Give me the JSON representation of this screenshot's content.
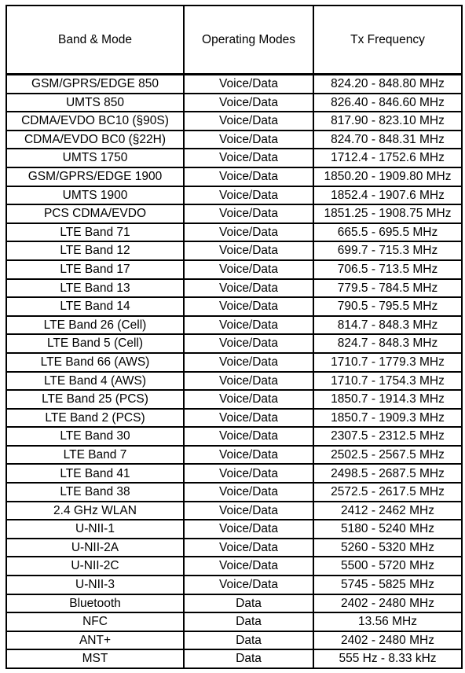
{
  "table": {
    "headers": [
      "Band & Mode",
      "Operating Modes",
      "Tx Frequency"
    ],
    "rows": [
      {
        "band": "GSM/GPRS/EDGE 850",
        "modes": "Voice/Data",
        "freq": "824.20 - 848.80 MHz"
      },
      {
        "band": "UMTS 850",
        "modes": "Voice/Data",
        "freq": "826.40 - 846.60 MHz"
      },
      {
        "band": "CDMA/EVDO BC10 (§90S)",
        "modes": "Voice/Data",
        "freq": "817.90 - 823.10 MHz"
      },
      {
        "band": "CDMA/EVDO BC0 (§22H)",
        "modes": "Voice/Data",
        "freq": "824.70 - 848.31 MHz"
      },
      {
        "band": "UMTS 1750",
        "modes": "Voice/Data",
        "freq": "1712.4 - 1752.6 MHz"
      },
      {
        "band": "GSM/GPRS/EDGE 1900",
        "modes": "Voice/Data",
        "freq": "1850.20 - 1909.80 MHz"
      },
      {
        "band": "UMTS 1900",
        "modes": "Voice/Data",
        "freq": "1852.4 - 1907.6 MHz"
      },
      {
        "band": "PCS CDMA/EVDO",
        "modes": "Voice/Data",
        "freq": "1851.25 - 1908.75 MHz"
      },
      {
        "band": "LTE Band 71",
        "modes": "Voice/Data",
        "freq": "665.5 - 695.5 MHz"
      },
      {
        "band": "LTE Band 12",
        "modes": "Voice/Data",
        "freq": "699.7 - 715.3 MHz"
      },
      {
        "band": "LTE Band 17",
        "modes": "Voice/Data",
        "freq": "706.5 - 713.5 MHz"
      },
      {
        "band": "LTE Band 13",
        "modes": "Voice/Data",
        "freq": "779.5 - 784.5 MHz"
      },
      {
        "band": "LTE Band 14",
        "modes": "Voice/Data",
        "freq": "790.5 - 795.5 MHz"
      },
      {
        "band": "LTE Band 26 (Cell)",
        "modes": "Voice/Data",
        "freq": "814.7 - 848.3 MHz"
      },
      {
        "band": "LTE Band 5 (Cell)",
        "modes": "Voice/Data",
        "freq": "824.7 - 848.3 MHz"
      },
      {
        "band": "LTE Band 66 (AWS)",
        "modes": "Voice/Data",
        "freq": "1710.7 - 1779.3 MHz"
      },
      {
        "band": "LTE Band 4 (AWS)",
        "modes": "Voice/Data",
        "freq": "1710.7 - 1754.3 MHz"
      },
      {
        "band": "LTE Band 25 (PCS)",
        "modes": "Voice/Data",
        "freq": "1850.7 - 1914.3 MHz"
      },
      {
        "band": "LTE Band 2 (PCS)",
        "modes": "Voice/Data",
        "freq": "1850.7 - 1909.3 MHz"
      },
      {
        "band": "LTE Band 30",
        "modes": "Voice/Data",
        "freq": "2307.5 - 2312.5 MHz"
      },
      {
        "band": "LTE Band 7",
        "modes": "Voice/Data",
        "freq": "2502.5 - 2567.5 MHz"
      },
      {
        "band": "LTE Band 41",
        "modes": "Voice/Data",
        "freq": "2498.5 - 2687.5 MHz"
      },
      {
        "band": "LTE Band 38",
        "modes": "Voice/Data",
        "freq": "2572.5 - 2617.5 MHz"
      },
      {
        "band": "2.4 GHz WLAN",
        "modes": "Voice/Data",
        "freq": "2412 - 2462 MHz"
      },
      {
        "band": "U-NII-1",
        "modes": "Voice/Data",
        "freq": "5180 - 5240 MHz"
      },
      {
        "band": "U-NII-2A",
        "modes": "Voice/Data",
        "freq": "5260 - 5320 MHz"
      },
      {
        "band": "U-NII-2C",
        "modes": "Voice/Data",
        "freq": "5500 - 5720 MHz"
      },
      {
        "band": "U-NII-3",
        "modes": "Voice/Data",
        "freq": "5745 - 5825 MHz"
      },
      {
        "band": "Bluetooth",
        "modes": "Data",
        "freq": "2402 - 2480 MHz"
      },
      {
        "band": "NFC",
        "modes": "Data",
        "freq": "13.56 MHz"
      },
      {
        "band": "ANT+",
        "modes": "Data",
        "freq": "2402 - 2480 MHz"
      },
      {
        "band": "MST",
        "modes": "Data",
        "freq": "555 Hz - 8.33 kHz"
      }
    ]
  }
}
